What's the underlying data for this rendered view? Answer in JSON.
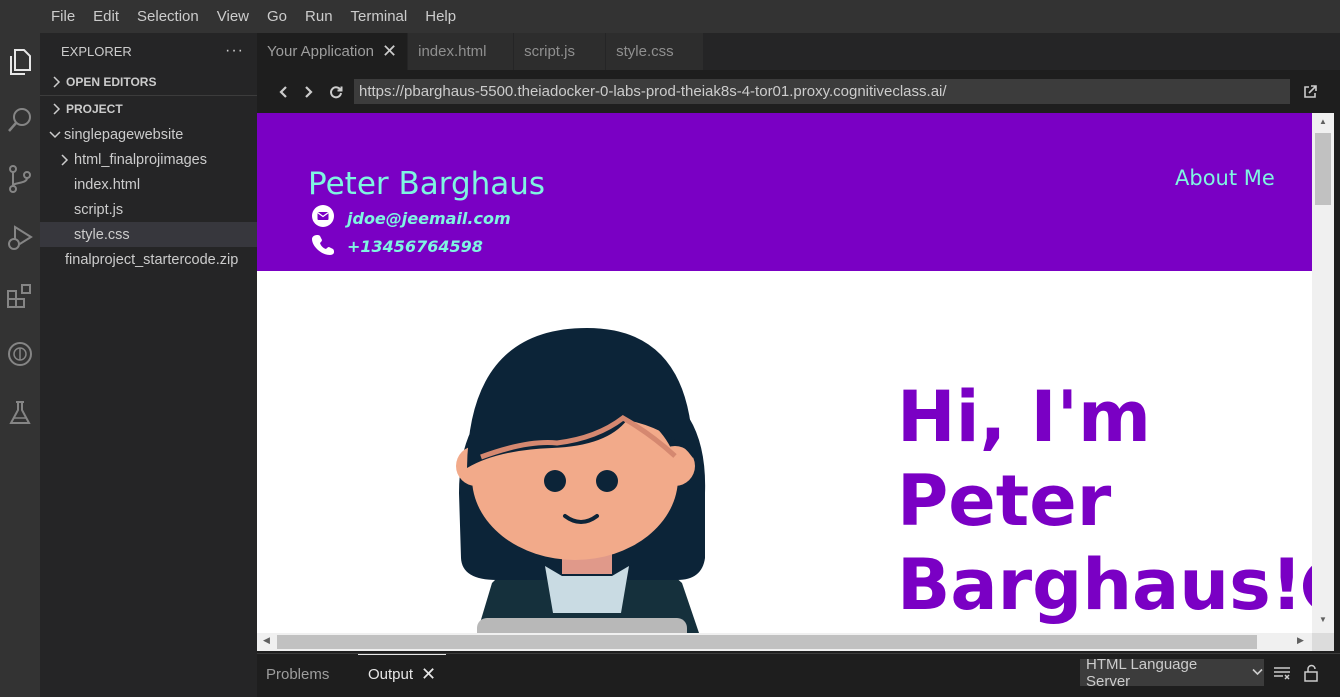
{
  "menu": [
    "File",
    "Edit",
    "Selection",
    "View",
    "Go",
    "Run",
    "Terminal",
    "Help"
  ],
  "sidebar": {
    "title": "EXPLORER",
    "more": "···",
    "open_editors": "OPEN EDITORS",
    "project": "PROJECT",
    "tree": {
      "root": "singlepagewebsite",
      "folder": "html_finalprojimages",
      "files": [
        "index.html",
        "script.js",
        "style.css"
      ],
      "zip": "finalproject_startercode.zip"
    }
  },
  "tabs": [
    "Your Application",
    "index.html",
    "script.js",
    "style.css"
  ],
  "browser": {
    "url": "https://pbarghaus-5500.theiadocker-0-labs-prod-theiak8s-4-tor01.proxy.cognitiveclass.ai/"
  },
  "site": {
    "name": "Peter Barghaus",
    "nav_about": "About Me",
    "email": "jdoe@jeemail.com",
    "phone": "+13456764598",
    "hero_line1": "Hi, I'm",
    "hero_line2": "Peter",
    "hero_line3": "Barghaus!"
  },
  "panel": {
    "problems": "Problems",
    "output": "Output",
    "channel": "HTML Language Server"
  },
  "colors": {
    "site_purple": "#7a00c4",
    "site_accent": "#7ff5e1"
  },
  "icons": [
    "explorer-icon",
    "search-icon",
    "source-control-icon",
    "run-debug-icon",
    "extensions-icon",
    "skills-network-icon",
    "lab-flask-icon"
  ]
}
